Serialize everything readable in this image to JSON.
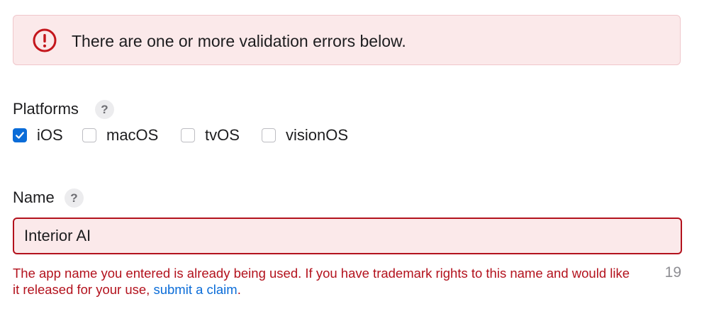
{
  "validation_banner": {
    "message": "There are one or more validation errors below.",
    "icon": "exclamation-circle-icon",
    "color": "#c4161c"
  },
  "platforms": {
    "label": "Platforms",
    "help": "?",
    "options": [
      {
        "label": "iOS",
        "checked": true
      },
      {
        "label": "macOS",
        "checked": false
      },
      {
        "label": "tvOS",
        "checked": false
      },
      {
        "label": "visionOS",
        "checked": false
      }
    ]
  },
  "name": {
    "label": "Name",
    "help": "?",
    "value": "Interior AI",
    "error_text": "The app name you entered is already being used. If you have trademark rights to this name and would like it released for your use, ",
    "error_link": "submit a claim",
    "error_suffix": ".",
    "char_count": "19"
  },
  "colors": {
    "error": "#b3121d",
    "error_bg": "#fbe9ea",
    "accent": "#0a6cd8"
  }
}
